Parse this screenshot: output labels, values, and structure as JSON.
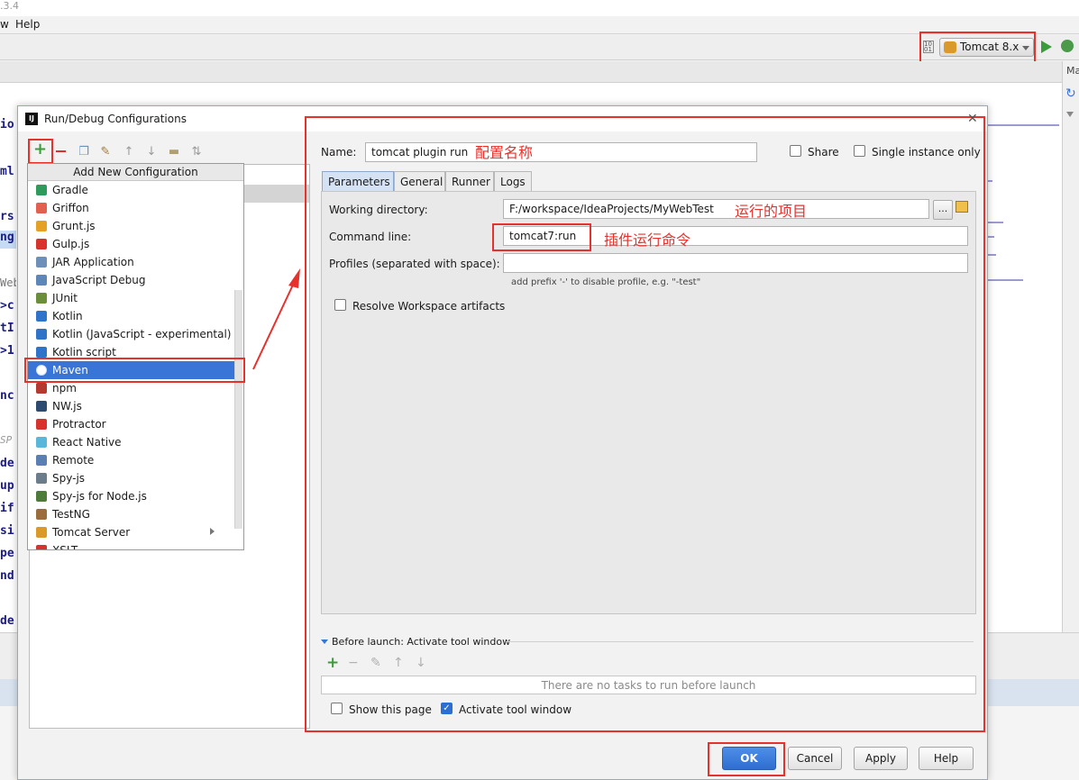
{
  "ide": {
    "title_fragment": ".3.4",
    "menu": {
      "view_fragment": "w",
      "help": "Help"
    },
    "run_config_combo": "Tomcat 8.x",
    "right_strip_label": "Ma",
    "code_fragments": [
      "io",
      "ml",
      "rs",
      "ng",
      "Web",
      ">c",
      "tI",
      ">1",
      "nc",
      "SP",
      "de",
      "up",
      "if",
      "si",
      "pe",
      "nd",
      "de"
    ]
  },
  "dialog": {
    "title": "Run/Debug Configurations",
    "popup": {
      "header": "Add New Configuration",
      "items": [
        {
          "label": "Gradle",
          "icon": "gradle-icon",
          "color": "#2e9a5b"
        },
        {
          "label": "Griffon",
          "icon": "griffon-icon",
          "color": "#e0614f"
        },
        {
          "label": "Grunt.js",
          "icon": "grunt-icon",
          "color": "#e4a126"
        },
        {
          "label": "Gulp.js",
          "icon": "gulp-icon",
          "color": "#d8322e"
        },
        {
          "label": "JAR Application",
          "icon": "jar-icon",
          "color": "#6d8fb8"
        },
        {
          "label": "JavaScript Debug",
          "icon": "js-debug-icon",
          "color": "#5e86b6"
        },
        {
          "label": "JUnit",
          "icon": "junit-icon",
          "color": "#6b8e3a"
        },
        {
          "label": "Kotlin",
          "icon": "kotlin-icon",
          "color": "#2f74c8"
        },
        {
          "label": "Kotlin (JavaScript - experimental)",
          "icon": "kotlin-icon",
          "color": "#2f74c8"
        },
        {
          "label": "Kotlin script",
          "icon": "kotlin-icon",
          "color": "#2f74c8"
        },
        {
          "label": "Maven",
          "icon": "maven-gear-icon",
          "color": "#ffffff"
        },
        {
          "label": "npm",
          "icon": "npm-icon",
          "color": "#b33a2e"
        },
        {
          "label": "NW.js",
          "icon": "nwjs-icon",
          "color": "#2d4b6e"
        },
        {
          "label": "Protractor",
          "icon": "protractor-icon",
          "color": "#d8322e"
        },
        {
          "label": "React Native",
          "icon": "react-icon",
          "color": "#59b7d9"
        },
        {
          "label": "Remote",
          "icon": "remote-icon",
          "color": "#5a7fb0"
        },
        {
          "label": "Spy-js",
          "icon": "spyjs-icon",
          "color": "#6b7d8a"
        },
        {
          "label": "Spy-js for Node.js",
          "icon": "spyjs-node-icon",
          "color": "#4d7c3a"
        },
        {
          "label": "TestNG",
          "icon": "testng-icon",
          "color": "#9c6d3c"
        },
        {
          "label": "Tomcat Server",
          "icon": "tomcat-icon",
          "color": "#d99a2b",
          "has_submenu": true
        },
        {
          "label": "XSLT",
          "icon": "xslt-icon",
          "color": "#d8322e"
        }
      ],
      "selected_index": 10
    },
    "name": {
      "label": "Name:",
      "value": "tomcat plugin run"
    },
    "share_label": "Share",
    "single_instance_label": "Single instance only",
    "tabs": [
      "Parameters",
      "General",
      "Runner",
      "Logs"
    ],
    "active_tab": "Parameters",
    "working_dir": {
      "label": "Working directory:",
      "value": "F:/workspace/IdeaProjects/MyWebTest"
    },
    "browse_label": "...",
    "command_line": {
      "label": "Command line:",
      "value": "tomcat7:run"
    },
    "profiles": {
      "label": "Profiles (separated with space):",
      "value": "",
      "hint": "add prefix '-' to disable profile, e.g. \"-test\""
    },
    "resolve_label": "Resolve Workspace artifacts",
    "before_launch": {
      "label": "Before launch: Activate tool window",
      "empty_text": "There are no tasks to run before launch"
    },
    "show_page_label": "Show this page",
    "activate_tool_label": "Activate tool window",
    "buttons": {
      "ok": "OK",
      "cancel": "Cancel",
      "apply": "Apply",
      "help": "Help"
    }
  },
  "annotations": {
    "config_name": "配置名称",
    "project": "运行的项目",
    "plugin_command": "插件运行命令"
  },
  "colors": {
    "annotation_red": "#e5322d",
    "selection_blue": "#3875d7",
    "ok_blue": "#2e6ed0",
    "green_add": "#3b9c3b"
  }
}
